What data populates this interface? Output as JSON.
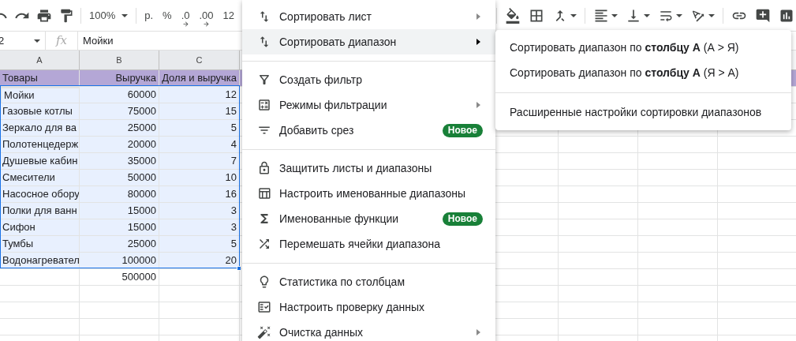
{
  "toolbar": {
    "zoom": "100%",
    "format_buttons": [
      "р.",
      "%",
      ".0",
      ".00",
      "12"
    ]
  },
  "formula_bar": {
    "cell_ref": "2",
    "fx_label": "fx",
    "formula": "Мойки"
  },
  "sheet": {
    "columns": [
      "A",
      "B",
      "C"
    ],
    "rows": [
      {
        "kind": "header",
        "cells": [
          "Товары",
          "Выручка",
          "Доля и выручка"
        ],
        "selected": false,
        "cursor": false
      },
      {
        "kind": "data",
        "cells": [
          "Мойки",
          "60000",
          "12"
        ],
        "selected": true,
        "cursor": true
      },
      {
        "kind": "data",
        "cells": [
          "Газовые котлы",
          "75000",
          "15"
        ],
        "selected": true,
        "cursor": false
      },
      {
        "kind": "data",
        "cells": [
          "Зеркало для ва",
          "25000",
          "5"
        ],
        "selected": true,
        "cursor": false
      },
      {
        "kind": "data",
        "cells": [
          "Полотенцедерж",
          "20000",
          "4"
        ],
        "selected": true,
        "cursor": false
      },
      {
        "kind": "data",
        "cells": [
          "Душевые кабин",
          "35000",
          "7"
        ],
        "selected": true,
        "cursor": false
      },
      {
        "kind": "data",
        "cells": [
          "Смесители",
          "50000",
          "10"
        ],
        "selected": true,
        "cursor": false
      },
      {
        "kind": "data",
        "cells": [
          "Насосное обору",
          "80000",
          "16"
        ],
        "selected": true,
        "cursor": false
      },
      {
        "kind": "data",
        "cells": [
          "Полки для ванн",
          "15000",
          "3"
        ],
        "selected": true,
        "cursor": false
      },
      {
        "kind": "data",
        "cells": [
          "Сифон",
          "15000",
          "3"
        ],
        "selected": true,
        "cursor": false
      },
      {
        "kind": "data",
        "cells": [
          "Тумбы",
          "25000",
          "5"
        ],
        "selected": true,
        "cursor": false
      },
      {
        "kind": "data",
        "cells": [
          "Водонагревател",
          "100000",
          "20"
        ],
        "selected": true,
        "cursor": false
      },
      {
        "kind": "data",
        "cells": [
          "",
          "500000",
          ""
        ],
        "selected": false,
        "cursor": false
      }
    ]
  },
  "menu": {
    "groups": [
      [
        {
          "label": "Сортировать лист",
          "has_submenu": true,
          "selected": false
        },
        {
          "label": "Сортировать диапазон",
          "has_submenu": true,
          "selected": true
        }
      ],
      [
        {
          "label": "Создать фильтр",
          "has_submenu": false,
          "selected": false
        },
        {
          "label": "Режимы фильтрации",
          "has_submenu": true,
          "selected": false
        },
        {
          "label": "Добавить срез",
          "has_submenu": false,
          "selected": false,
          "badge": "Новое"
        }
      ],
      [
        {
          "label": "Защитить листы и диапазоны",
          "has_submenu": false,
          "selected": false
        },
        {
          "label": "Настроить именованные диапазоны",
          "has_submenu": false,
          "selected": false
        },
        {
          "label": "Именованные функции",
          "has_submenu": false,
          "selected": false,
          "badge": "Новое"
        },
        {
          "label": "Перемешать ячейки диапазона",
          "has_submenu": false,
          "selected": false
        }
      ],
      [
        {
          "label": "Статистика по столбцам",
          "has_submenu": false,
          "selected": false
        },
        {
          "label": "Настроить проверку данных",
          "has_submenu": false,
          "selected": false
        },
        {
          "label": "Очистка данных",
          "has_submenu": true,
          "selected": false
        }
      ]
    ]
  },
  "submenu": {
    "groups": [
      [
        "Сортировать диапазон по **столбцу A** (А > Я)",
        "Сортировать диапазон по **столбцу A** (Я > А)"
      ],
      [
        "Расширенные настройки сортировки диапазонов"
      ]
    ]
  }
}
